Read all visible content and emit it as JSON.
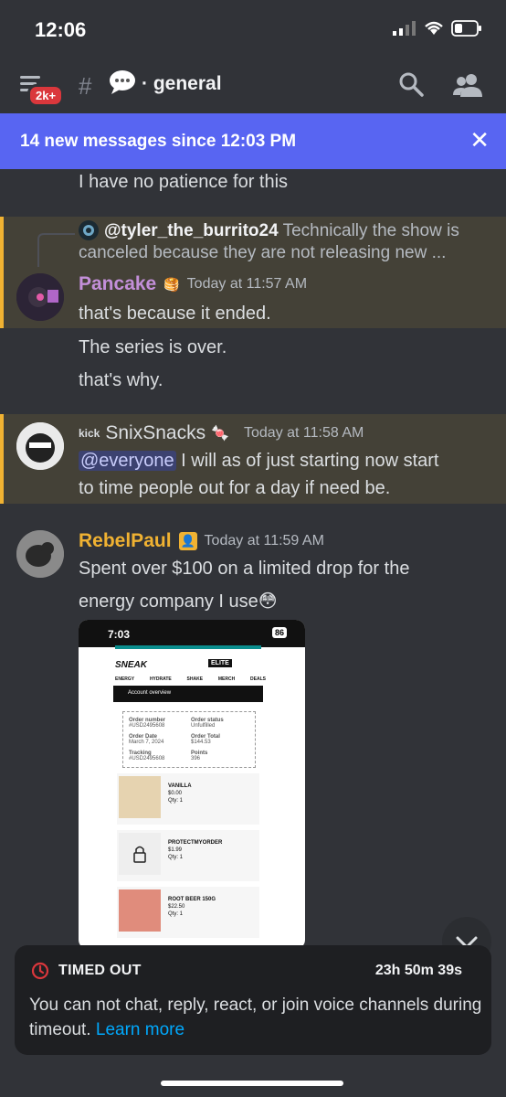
{
  "status_bar": {
    "time": "12:06"
  },
  "top_bar": {
    "badge": "2k+",
    "channel": "· general"
  },
  "new_messages": {
    "text": "14 new messages since 12:03 PM",
    "close": "✕"
  },
  "messages": {
    "prev_line": "I have no patience for this",
    "reply": {
      "user": "@tyler_the_burrito24",
      "preview_1": "Technically the show is",
      "preview_2": "canceled because they are not releasing new ..."
    },
    "pancake": {
      "name": "Pancake",
      "time": "Today at 11:57 AM",
      "lines": [
        "that's because it ended.",
        "The series is over.",
        "that's why."
      ]
    },
    "snix": {
      "tag": "kick",
      "name": "SnixSnacks",
      "time": "Today at 11:58 AM",
      "mention": "@everyone",
      "line_1": " I will as of just starting now start",
      "line_2": "to time people out for a day if need be."
    },
    "rebel": {
      "name": "RebelPaul",
      "time": "Today at 11:59 AM",
      "line_1": "Spent over $100 on a limited drop for the",
      "line_2": "energy company I use😳"
    }
  },
  "embed": {
    "time": "7:03",
    "battery": "86",
    "brand": "SNEAK",
    "brand2": "ELITE",
    "nav": [
      "ENERGY",
      "HYDRATE",
      "SHAKE",
      "MERCH",
      "DEALS"
    ],
    "account": "Account overview",
    "order_number_label": "Order number",
    "order_number": "#USD2495608",
    "order_status_label": "Order status",
    "order_status": "Unfulfilled",
    "order_date_label": "Order Date",
    "order_date": "March 7, 2024",
    "order_total_label": "Order Total",
    "order_total": "$144.53",
    "tracking_label": "Tracking",
    "tracking": "#USD2495608",
    "points_label": "Points",
    "points": "396",
    "items": [
      {
        "name": "VANILLA",
        "price": "$0.00",
        "qty": "Qty: 1"
      },
      {
        "name": "PROTECTMYORDER",
        "price": "$1.99",
        "qty": "Qty: 1"
      },
      {
        "name": "ROOT BEER 150G",
        "price": "$22.50",
        "qty": "Qty: 1"
      }
    ]
  },
  "timeout": {
    "title": "TIMED OUT",
    "timer": "23h 50m 39s",
    "body": "You can not chat, reply, react, or join voice channels during timeout.",
    "link": "Learn more"
  },
  "colors": {
    "blurple": "#5865f2",
    "pancake": "#c38fd9",
    "snix": "#dbdee1",
    "rebel": "#f0b232",
    "link": "#00a8fc"
  }
}
